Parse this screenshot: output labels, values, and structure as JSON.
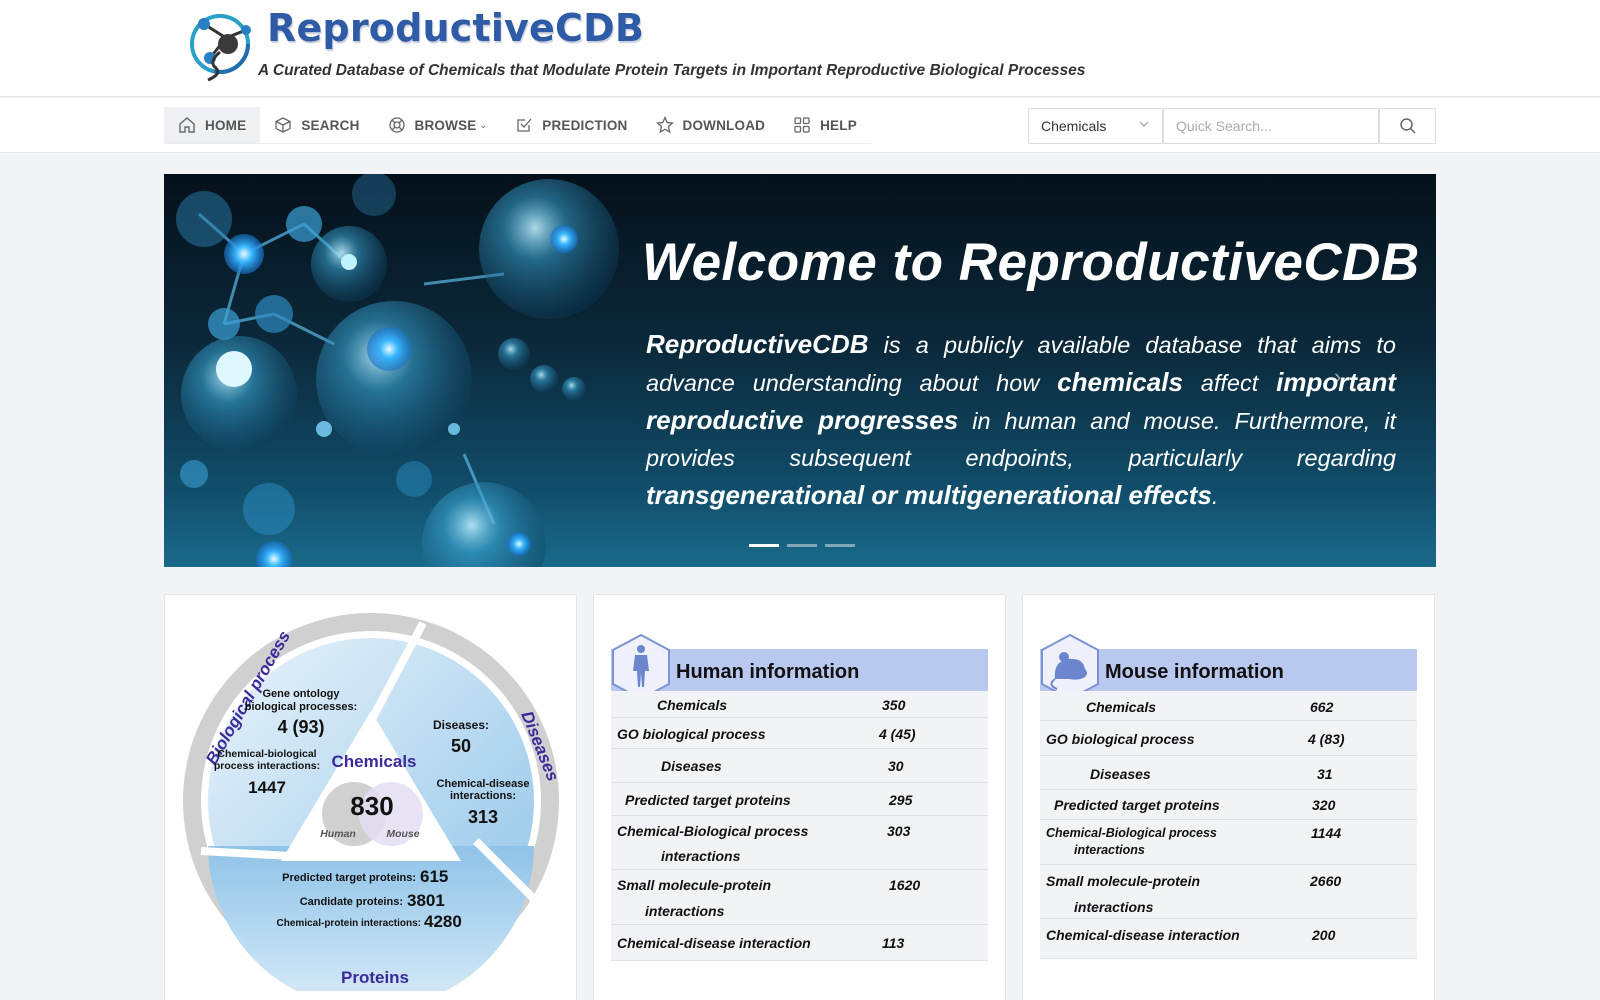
{
  "header": {
    "title": "ReproductiveCDB",
    "subtitle": "A Curated Database of Chemicals that Modulate Protein Targets in Important Reproductive Biological Processes"
  },
  "nav": {
    "items": [
      {
        "label": "HOME",
        "icon": "home-icon"
      },
      {
        "label": "SEARCH",
        "icon": "cube-icon"
      },
      {
        "label": "BROWSE",
        "icon": "lifebuoy-icon"
      },
      {
        "label": "PREDICTION",
        "icon": "checkbox-icon"
      },
      {
        "label": "DOWNLOAD",
        "icon": "star-icon"
      },
      {
        "label": "HELP",
        "icon": "grid-icon"
      }
    ],
    "search_category": "Chemicals",
    "search_placeholder": "Quick Search..."
  },
  "banner": {
    "title": "Welcome to ReproductiveCDB",
    "p1": "ReproductiveCDB",
    "p2": " is a publicly available database that aims to advance understanding about how ",
    "p3": "chemicals",
    "p4": " affect ",
    "p5": "important reproductive progresses",
    "p6": " in human and mouse. Furthermore, it provides subsequent endpoints, particularly regarding ",
    "p7": "transgenerational or multigenerational effects",
    "p8": ".",
    "slides": 3,
    "active_slide": 1
  },
  "overview": {
    "ring_biological": "Biological process",
    "ring_diseases": "Diseases",
    "ring_proteins": "Proteins",
    "go_label_1": "Gene ontology",
    "go_label_2": "biological processes:",
    "go_value": "4 (93)",
    "cbp_label_1": "Chemical-biological",
    "cbp_label_2": "process interactions:",
    "cbp_value": "1447",
    "diseases_label": "Diseases:",
    "diseases_value": "50",
    "cd_label_1": "Chemical-disease",
    "cd_label_2": "interactions:",
    "cd_value": "313",
    "chemicals_label": "Chemicals",
    "chemicals_value": "830",
    "human_label": "Human",
    "mouse_label": "Mouse",
    "ptp_label": "Predicted target proteins:",
    "ptp_value": "615",
    "cp_label": "Candidate proteins:",
    "cp_value": "3801",
    "cpi_label": "Chemical-protein interactions:",
    "cpi_value": "4280"
  },
  "human": {
    "title": "Human information",
    "rows": [
      {
        "label": "Chemicals",
        "value": "350"
      },
      {
        "label": "GO biological process",
        "value": "4 (45)"
      },
      {
        "label": "Diseases",
        "value": "30"
      },
      {
        "label": "Predicted target proteins",
        "value": "295"
      },
      {
        "label": "Chemical-Biological process",
        "label2": "interactions",
        "value": "303"
      },
      {
        "label": "Small molecule-protein",
        "label2": "interactions",
        "value": "1620"
      },
      {
        "label": "Chemical-disease interaction",
        "value": "113"
      }
    ]
  },
  "mouse": {
    "title": "Mouse information",
    "rows": [
      {
        "label": "Chemicals",
        "value": "662"
      },
      {
        "label": "GO biological process",
        "value": "4 (83)"
      },
      {
        "label": "Diseases",
        "value": "31"
      },
      {
        "label": "Predicted target proteins",
        "value": "320"
      },
      {
        "label": "Chemical-Biological process",
        "label2": "interactions",
        "value": "1144"
      },
      {
        "label": "Small molecule-protein",
        "label2": "interactions",
        "value": "2660"
      },
      {
        "label": "Chemical-disease interaction",
        "value": "200"
      }
    ]
  },
  "colors": {
    "brand": "#2e5aa6",
    "accent_purple": "#3a2a9a",
    "header_band": "#b9c8ee"
  }
}
